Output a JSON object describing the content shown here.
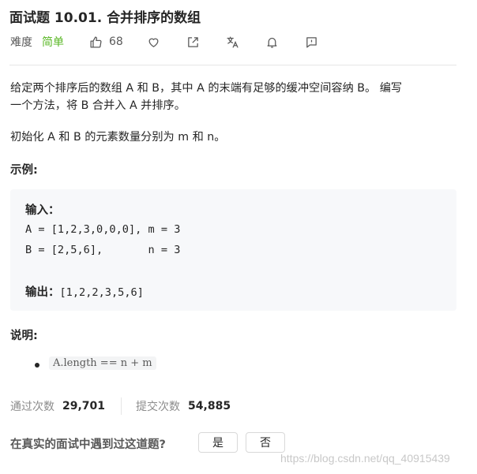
{
  "problem": {
    "title": "面试题 10.01. 合并排序的数组",
    "difficulty_label": "难度",
    "difficulty": "简单",
    "likes": "68"
  },
  "icons": [
    "thumbs-up-icon",
    "heart-icon",
    "share-icon",
    "translate-icon",
    "bell-icon",
    "feedback-icon"
  ],
  "colors": {
    "difficulty_easy": "#5ab726",
    "code_bg": "#f7f8fa"
  },
  "description": {
    "p1_line1": "给定两个排序后的数组 A 和 B，其中 A 的末端有足够的缓冲空间容纳 B。 编写",
    "p1_line2": "一个方法，将 B 合并入 A 并排序。",
    "p2": "初始化 A 和 B 的元素数量分别为 m 和 n。"
  },
  "example": {
    "heading": "示例:",
    "input_label": "输入：",
    "line_a": "A = [1,2,3,0,0,0], m = 3",
    "line_b": "B = [2,5,6],       n = 3",
    "output_label": "输出：",
    "output_value": "[1,2,2,3,5,6]"
  },
  "notes": {
    "heading": "说明:",
    "items": [
      "A.length == n + m"
    ]
  },
  "stats": {
    "accepted_label": "通过次数",
    "accepted_value": "29,701",
    "submissions_label": "提交次数",
    "submissions_value": "54,885"
  },
  "interview": {
    "question": "在真实的面试中遇到过这道题?",
    "yes": "是",
    "no": "否"
  },
  "watermark": "https://blog.csdn.net/qq_40915439"
}
